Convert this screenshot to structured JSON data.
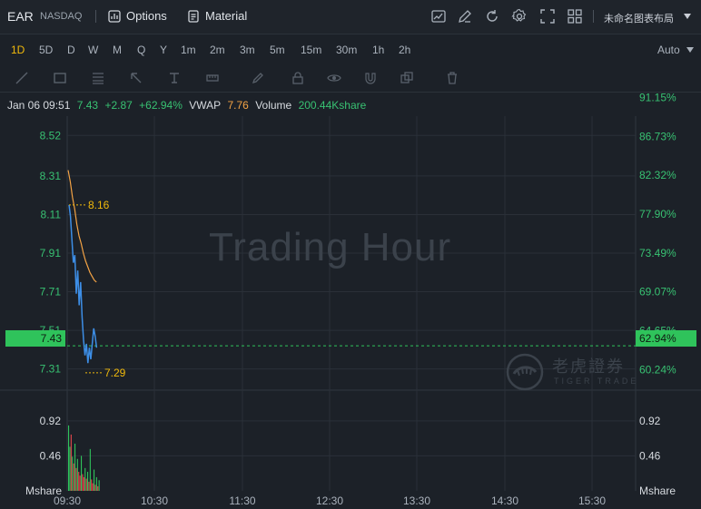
{
  "topbar": {
    "symbol": "EAR",
    "exchange": "NASDAQ",
    "options_label": "Options",
    "material_label": "Material",
    "layout_label": "未命名图表布局",
    "icons": [
      "chart-icon",
      "edit-icon",
      "refresh-icon",
      "settings-icon",
      "fullscreen-icon",
      "grid-layout-icon"
    ]
  },
  "periods": {
    "items": [
      "1D",
      "5D",
      "D",
      "W",
      "M",
      "Q",
      "Y",
      "1m",
      "2m",
      "3m",
      "5m",
      "15m",
      "30m",
      "1h",
      "2h"
    ],
    "active": "1D",
    "scale_mode": "Auto"
  },
  "drawing_tools": [
    "line-tool-icon",
    "rectangle-tool-icon",
    "fib-tool-icon",
    "arrow-tool-icon",
    "text-tool-icon",
    "measure-tool-icon",
    "pencil-icon",
    "lock-icon",
    "eye-icon",
    "magnet-icon",
    "layers-icon",
    "trash-icon"
  ],
  "info_line": {
    "datetime": "Jan 06 09:51",
    "price": "7.43",
    "change": "+2.87",
    "change_pct": "+62.94%",
    "vwap_label": "VWAP",
    "vwap": "7.76",
    "volume_label": "Volume",
    "volume": "200.44Kshare"
  },
  "watermark": "Trading Hour",
  "brand": {
    "name": "老虎證券",
    "en": "TIGER TRADE"
  },
  "colors": {
    "up": "#2fc35b",
    "down": "#e5484d",
    "price_line": "#3d8ee6",
    "vwap_line": "#f3a345",
    "marker": "#f0b90b"
  },
  "chart_data": {
    "type": "line",
    "price_axis": {
      "ticks": [
        "8.52",
        "8.31",
        "8.11",
        "7.91",
        "7.71",
        "7.51",
        "7.31"
      ],
      "current": "7.43"
    },
    "percent_axis": {
      "ticks": [
        "91.15%",
        "86.73%",
        "82.32%",
        "77.90%",
        "73.49%",
        "69.07%",
        "64.65%",
        "60.24%"
      ],
      "current": "62.94%"
    },
    "volume_axis": {
      "ticks": [
        "0.92",
        "0.46"
      ],
      "unit": "Mshare"
    },
    "time_axis": [
      "09:30",
      "10:30",
      "11:30",
      "12:30",
      "13:30",
      "14:30",
      "15:30"
    ],
    "high_label": "8.16",
    "low_label": "7.29",
    "ylim": [
      7.2,
      8.62
    ],
    "price_series": [
      8.16,
      8.1,
      7.98,
      7.86,
      7.9,
      7.7,
      7.82,
      7.64,
      7.76,
      7.58,
      7.46,
      7.38,
      7.44,
      7.34,
      7.42,
      7.36,
      7.44,
      7.52,
      7.48,
      7.42
    ],
    "vwap_series": [
      8.34,
      8.28,
      8.2,
      8.14,
      8.06,
      8.0,
      7.96,
      7.91,
      7.87,
      7.84,
      7.81,
      7.79,
      7.77,
      7.76
    ],
    "volume_series": [
      0.86,
      0.58,
      0.74,
      0.45,
      0.36,
      0.62,
      0.3,
      0.42,
      0.25,
      0.2,
      0.46,
      0.22,
      0.18,
      0.3,
      0.16,
      0.25,
      0.12,
      0.55,
      0.15,
      0.1,
      0.28,
      0.08,
      0.18,
      0.06,
      0.14
    ],
    "volume_up": [
      true,
      true,
      false,
      true,
      false,
      true,
      false,
      true,
      false,
      false,
      true,
      false,
      false,
      true,
      false,
      true,
      false,
      true,
      false,
      false,
      true,
      false,
      true,
      false,
      true
    ]
  }
}
